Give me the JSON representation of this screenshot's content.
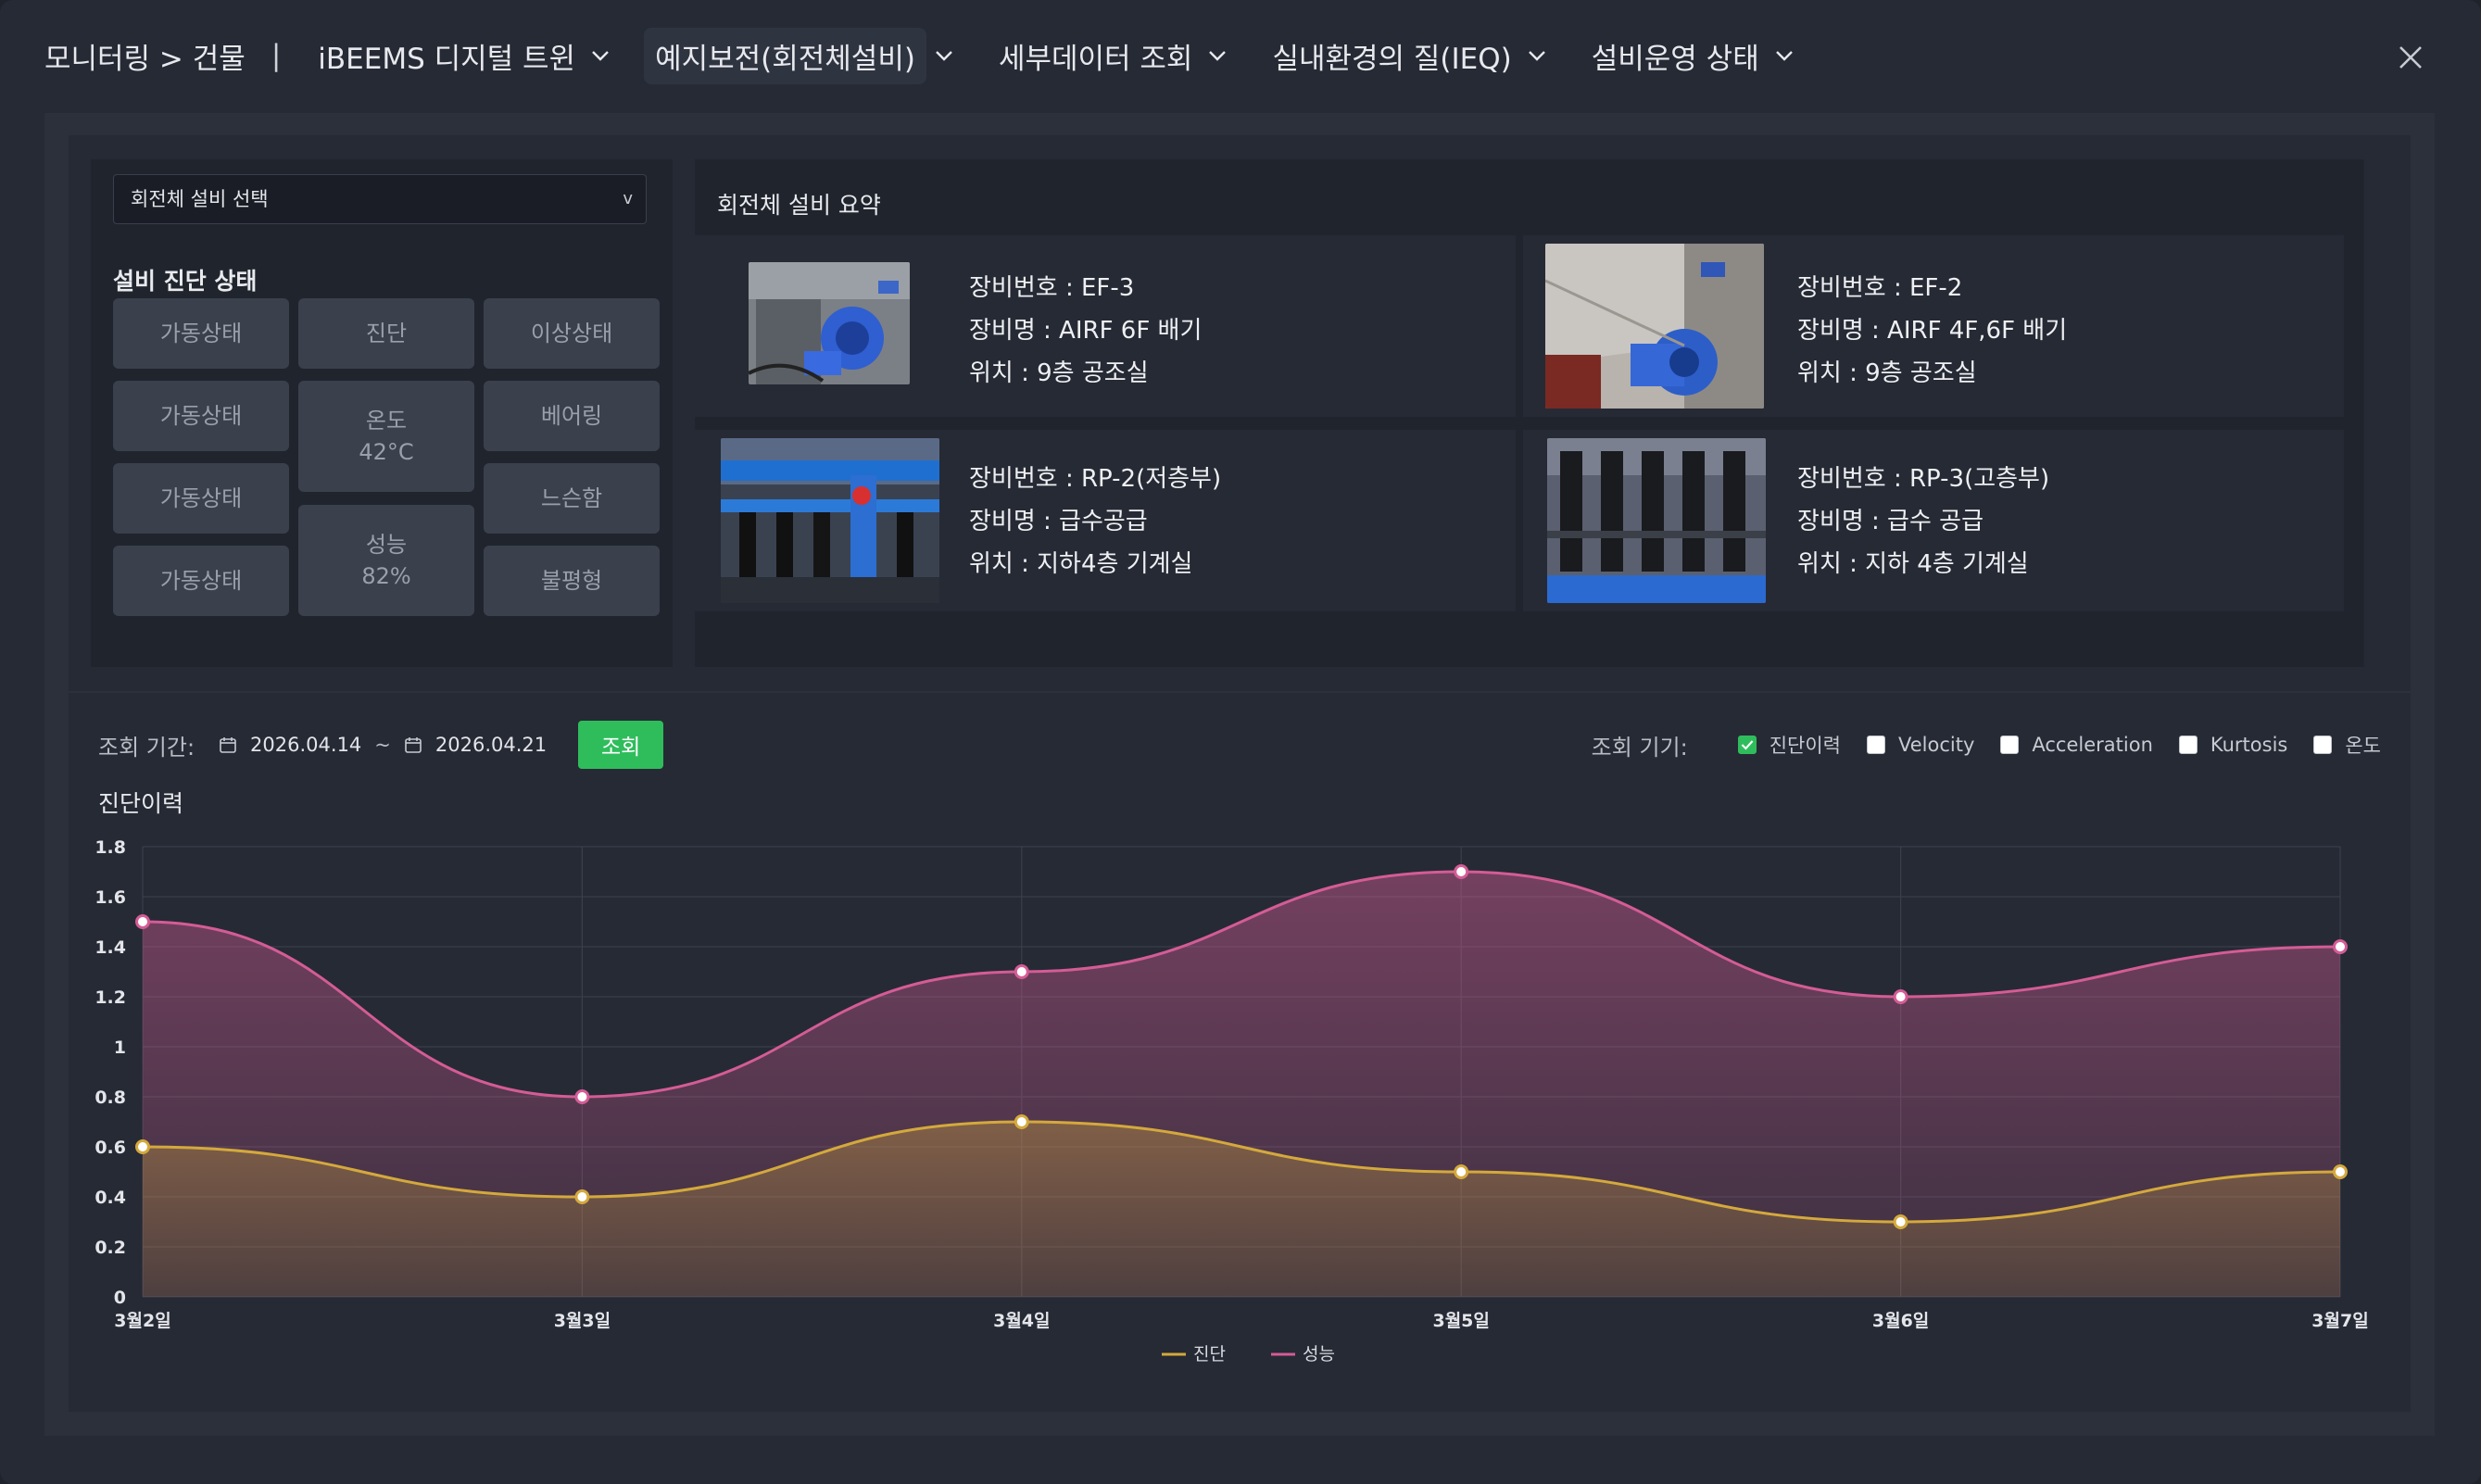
{
  "header": {
    "breadcrumb": "모니터링 > 건물",
    "separator": "|",
    "nav": [
      {
        "label": "iBEEMS 디지털 트윈",
        "active": false
      },
      {
        "label": "예지보전(회전체설비)",
        "active": true
      },
      {
        "label": "세부데이터 조회",
        "active": false
      },
      {
        "label": "실내환경의 질(IEQ)",
        "active": false
      },
      {
        "label": "설비운영 상태",
        "active": false
      }
    ],
    "close_icon": "close-icon"
  },
  "left_panel": {
    "select_placeholder": "회전체 설비 선택",
    "select_caret": "v",
    "diagnosis_title": "설비 진단 상태",
    "buttons": {
      "op1": "가동상태",
      "op2": "가동상태",
      "op3": "가동상태",
      "op4": "가동상태",
      "diag": "진단",
      "temp_label": "온도",
      "temp_value": "42°C",
      "perf_label": "성능",
      "perf_value": "82%",
      "abnormal": "이상상태",
      "bearing": "베어링",
      "loose": "느슨함",
      "unbalance": "불평형"
    }
  },
  "summary": {
    "title": "회전체 설비 요약",
    "equipment": [
      {
        "id": "장비번호 : EF-3",
        "name": "장비명 : AIRF 6F 배기",
        "loc": "위치 : 9층 공조실"
      },
      {
        "id": "장비번호 : EF-2",
        "name": "장비명 : AIRF 4F,6F 배기",
        "loc": "위치 : 9층 공조실"
      },
      {
        "id": "장비번호 : RP-2(저층부)",
        "name": "장비명 : 급수공급",
        "loc": "위치 : 지하4층 기계실"
      },
      {
        "id": "장비번호 : RP-3(고층부)",
        "name": "장비명 : 급수 공급",
        "loc": "위치 : 지하 4층 기계실"
      }
    ]
  },
  "query": {
    "period_label": "조회 기간:",
    "start_date": "2026.04.14",
    "tilde": "~",
    "end_date": "2026.04.21",
    "button": "조회",
    "device_label": "조회 기기:",
    "options": [
      {
        "label": "진단이력",
        "checked": true
      },
      {
        "label": "Velocity",
        "checked": false
      },
      {
        "label": "Acceleration",
        "checked": false
      },
      {
        "label": "Kurtosis",
        "checked": false
      },
      {
        "label": "온도",
        "checked": false
      }
    ]
  },
  "chart_title": "진단이력",
  "chart_data": {
    "type": "area",
    "categories": [
      "3월2일",
      "3월3일",
      "3월4일",
      "3월5일",
      "3월6일",
      "3월7일"
    ],
    "series": [
      {
        "name": "진단",
        "values": [
          0.6,
          0.4,
          0.7,
          0.5,
          0.3,
          0.5
        ],
        "color": "#d4a93c"
      },
      {
        "name": "성능",
        "values": [
          1.5,
          0.8,
          1.3,
          1.7,
          1.2,
          1.4
        ],
        "color": "#d45c96"
      }
    ],
    "ylim": [
      0,
      1.8
    ],
    "yticks": [
      "0",
      "0.2",
      "0.4",
      "0.6",
      "0.8",
      "1",
      "1.2",
      "1.4",
      "1.6",
      "1.8"
    ],
    "grid": true,
    "legend": "bottom-center",
    "smooth": true
  },
  "colors": {
    "accent_green": "#2fbd5c",
    "diag_line": "#d4a93c",
    "perf_line": "#d45c96"
  }
}
